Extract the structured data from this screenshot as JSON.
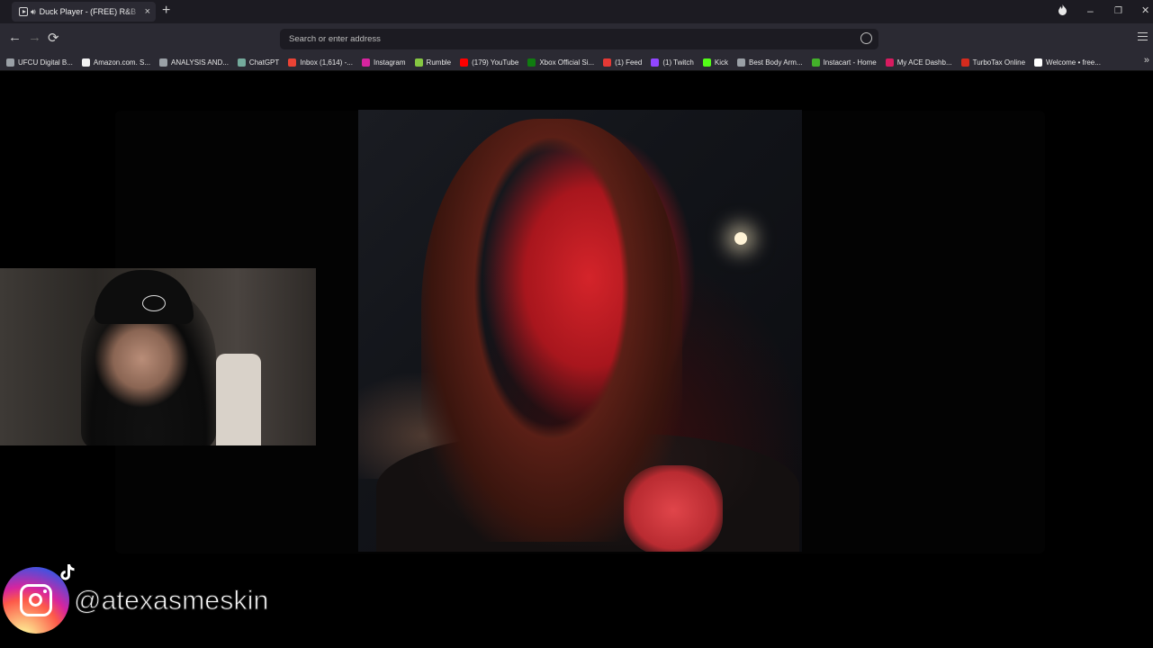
{
  "browser": {
    "tab": {
      "title": "Duck Player - (FREE) R&B",
      "audio_icon": "speaker-icon",
      "close_label": "×"
    },
    "new_tab_label": "+",
    "window_controls": {
      "fire": "🜂",
      "minimize": "–",
      "restore": "❐",
      "close": "✕"
    },
    "nav": {
      "back": "←",
      "forward": "→",
      "reload": "⟳"
    },
    "address_bar": {
      "placeholder": "Search or enter address",
      "value": ""
    },
    "bookmarks": [
      {
        "label": "UFCU Digital B...",
        "color": "#9aa0a6"
      },
      {
        "label": "Amazon.com. S...",
        "color": "#f2f2f2"
      },
      {
        "label": "ANALYSIS AND...",
        "color": "#9aa0a6"
      },
      {
        "label": "ChatGPT",
        "color": "#74aa9c"
      },
      {
        "label": "Inbox (1,614) -...",
        "color": "#ea4335"
      },
      {
        "label": "Instagram",
        "color": "#d6249f"
      },
      {
        "label": "Rumble",
        "color": "#85c742"
      },
      {
        "label": "(179) YouTube",
        "color": "#ff0000"
      },
      {
        "label": "Xbox Official Si...",
        "color": "#107c10"
      },
      {
        "label": "(1) Feed",
        "color": "#e53935"
      },
      {
        "label": "(1) Twitch",
        "color": "#9146ff"
      },
      {
        "label": "Kick",
        "color": "#53fc18"
      },
      {
        "label": "Best Body Arm...",
        "color": "#9aa0a6"
      },
      {
        "label": "Instacart - Home",
        "color": "#43b02a"
      },
      {
        "label": "My ACE Dashb...",
        "color": "#d81b60"
      },
      {
        "label": "TurboTax Online",
        "color": "#d52b1e"
      },
      {
        "label": "Welcome • free...",
        "color": "#ffffff"
      }
    ],
    "bookmarks_overflow": "»"
  },
  "overlay": {
    "instagram_handle": "@atexasmeskin"
  }
}
